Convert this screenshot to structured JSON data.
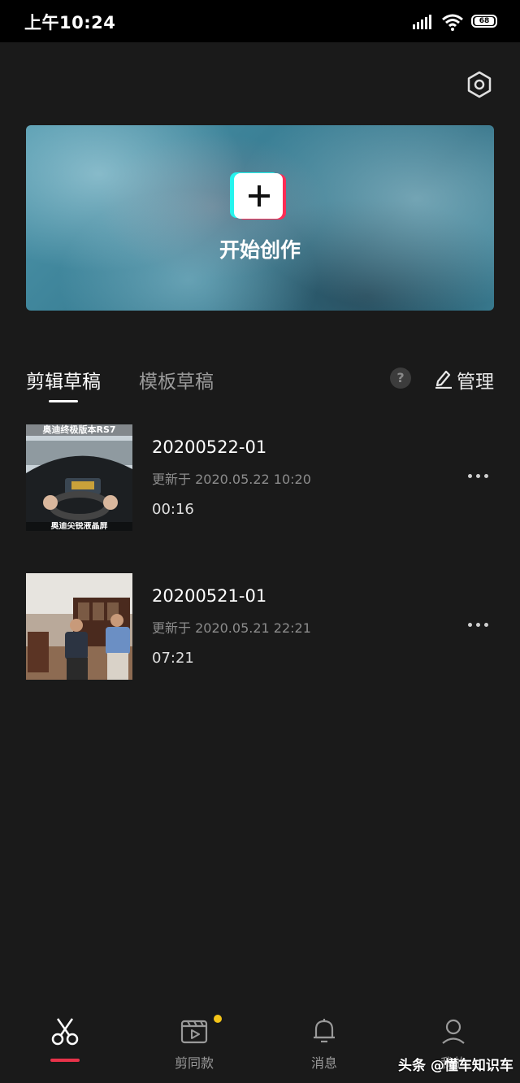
{
  "status_bar": {
    "time": "上午10:24",
    "battery": "68",
    "icons": [
      "signal-icon",
      "wifi-icon",
      "battery-icon"
    ]
  },
  "header": {
    "settings_icon": "hexagon-settings-icon"
  },
  "banner": {
    "create_label": "开始创作",
    "create_icon": "plus-icon"
  },
  "tabs": [
    {
      "label": "剪辑草稿",
      "active": true
    },
    {
      "label": "模板草稿",
      "active": false
    }
  ],
  "toolbar": {
    "help_label": "?",
    "manage_label": "管理"
  },
  "drafts": [
    {
      "title": "20200522-01",
      "updated": "更新于 2020.05.22 10:20",
      "duration": "00:16",
      "thumb_overlay_top": "奥迪终极版本RS7",
      "thumb_overlay_bottom": "奥迪尖锐液晶屏"
    },
    {
      "title": "20200521-01",
      "updated": "更新于 2020.05.21 22:21",
      "duration": "07:21"
    }
  ],
  "bottom_nav": [
    {
      "label": "",
      "icon": "scissors-icon",
      "active": true
    },
    {
      "label": "剪同款",
      "icon": "clapperboard-play-icon",
      "active": false,
      "badge": true
    },
    {
      "label": "消息",
      "icon": "bell-icon",
      "active": false
    },
    {
      "label": "我的",
      "icon": "profile-icon",
      "active": false
    }
  ],
  "watermark": "头条 @懂车知识车",
  "colors": {
    "background": "#1a1a1a",
    "accent_red": "#e8334a",
    "badge_yellow": "#f5c518",
    "tiktok_cyan": "#25f4ee",
    "tiktok_red": "#fe2c55"
  }
}
